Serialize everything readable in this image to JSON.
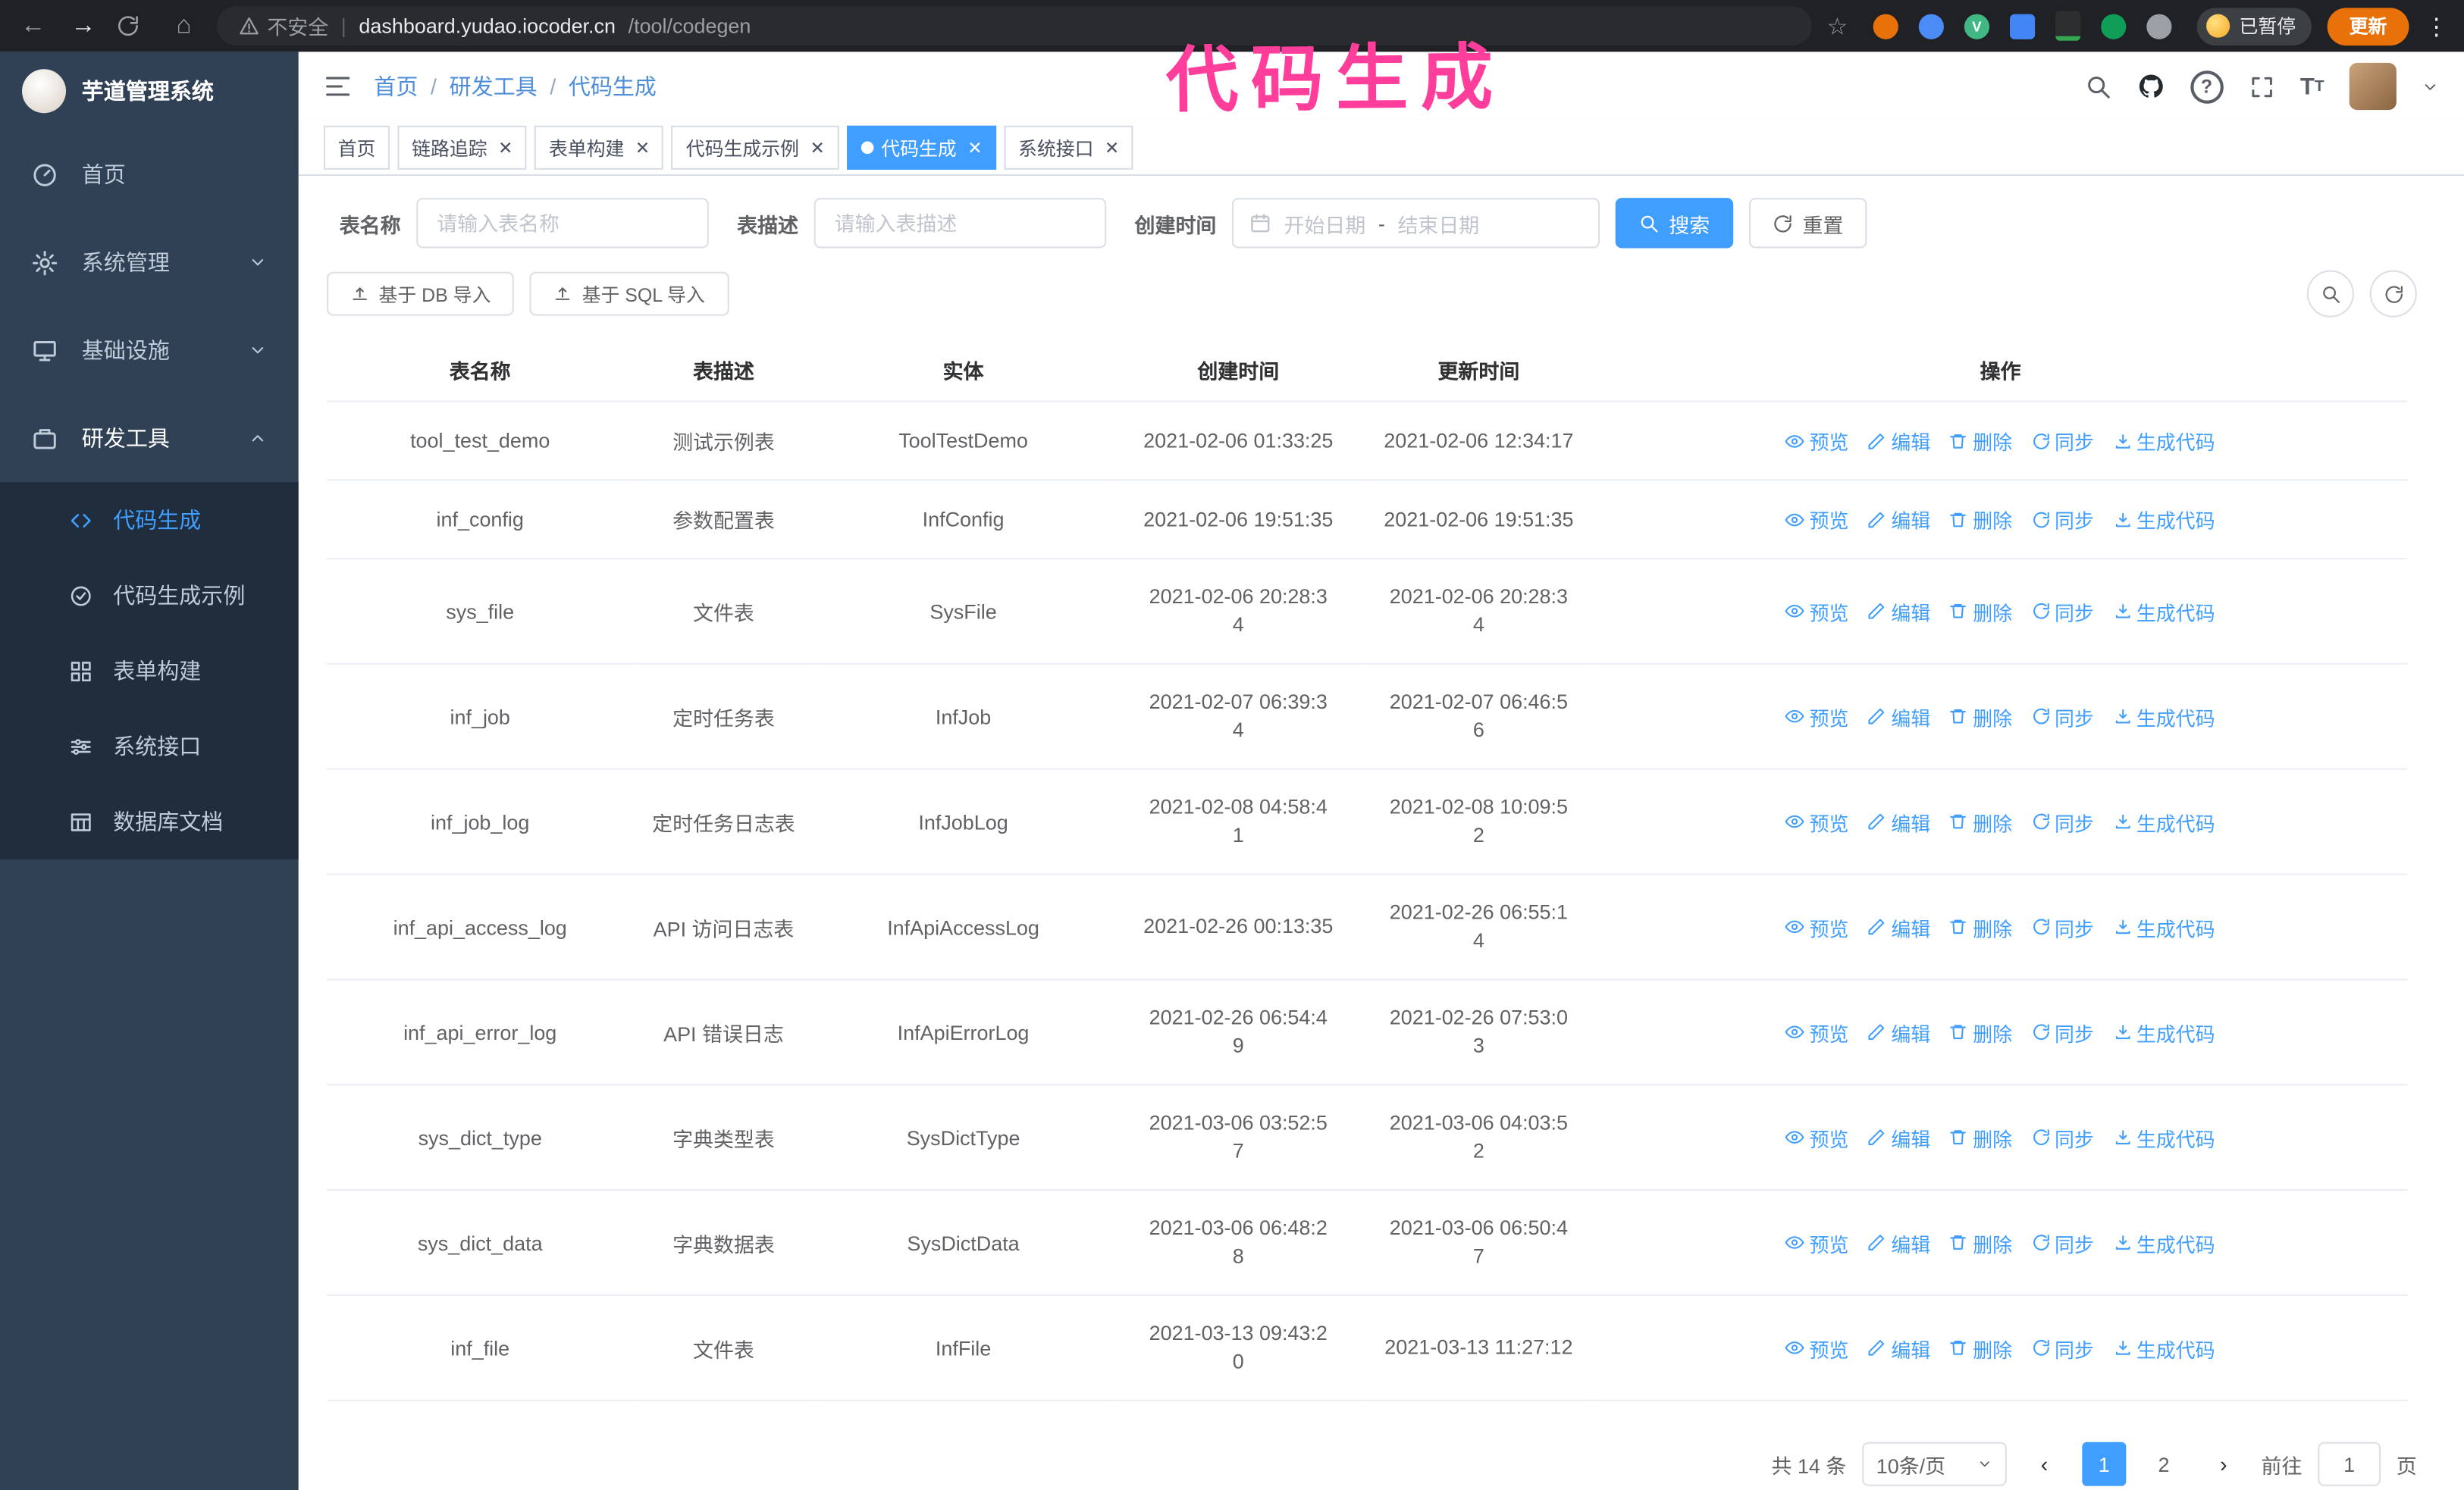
{
  "browser": {
    "security_label": "不安全",
    "url_host": "dashboard.yudao.iocoder.cn",
    "url_path": "/tool/codegen",
    "paused_badge": "已暂停",
    "update_button": "更新"
  },
  "annotation": {
    "text": "代码生成"
  },
  "sidebar": {
    "logo_title": "芋道管理系统",
    "items": [
      {
        "label": "首页"
      },
      {
        "label": "系统管理"
      },
      {
        "label": "基础设施"
      },
      {
        "label": "研发工具"
      }
    ],
    "submenu": [
      {
        "label": "代码生成",
        "active": true
      },
      {
        "label": "代码生成示例"
      },
      {
        "label": "表单构建"
      },
      {
        "label": "系统接口"
      },
      {
        "label": "数据库文档"
      }
    ]
  },
  "header": {
    "breadcrumb": [
      "首页",
      "研发工具",
      "代码生成"
    ]
  },
  "tabs": [
    {
      "label": "首页",
      "closable": false
    },
    {
      "label": "链路追踪",
      "closable": true
    },
    {
      "label": "表单构建",
      "closable": true
    },
    {
      "label": "代码生成示例",
      "closable": true
    },
    {
      "label": "代码生成",
      "closable": true,
      "active": true
    },
    {
      "label": "系统接口",
      "closable": true
    }
  ],
  "filters": {
    "table_name_label": "表名称",
    "table_name_placeholder": "请输入表名称",
    "table_desc_label": "表描述",
    "table_desc_placeholder": "请输入表描述",
    "create_time_label": "创建时间",
    "date_start_placeholder": "开始日期",
    "date_separator": "-",
    "date_end_placeholder": "结束日期",
    "search_button": "搜索",
    "reset_button": "重置"
  },
  "toolbar": {
    "import_db": "基于 DB 导入",
    "import_sql": "基于 SQL 导入"
  },
  "table": {
    "columns": [
      "表名称",
      "表描述",
      "实体",
      "创建时间",
      "更新时间",
      "操作"
    ],
    "actions": [
      "预览",
      "编辑",
      "删除",
      "同步",
      "生成代码"
    ],
    "rows": [
      {
        "name": "tool_test_demo",
        "desc": "测试示例表",
        "entity": "ToolTestDemo",
        "created": "2021-02-06 01:33:25",
        "updated": "2021-02-06 12:34:17"
      },
      {
        "name": "inf_config",
        "desc": "参数配置表",
        "entity": "InfConfig",
        "created": "2021-02-06 19:51:35",
        "updated": "2021-02-06 19:51:35"
      },
      {
        "name": "sys_file",
        "desc": "文件表",
        "entity": "SysFile",
        "created": "2021-02-06 20:28:3\n4",
        "updated": "2021-02-06 20:28:3\n4"
      },
      {
        "name": "inf_job",
        "desc": "定时任务表",
        "entity": "InfJob",
        "created": "2021-02-07 06:39:3\n4",
        "updated": "2021-02-07 06:46:5\n6"
      },
      {
        "name": "inf_job_log",
        "desc": "定时任务日志表",
        "entity": "InfJobLog",
        "created": "2021-02-08 04:58:4\n1",
        "updated": "2021-02-08 10:09:5\n2"
      },
      {
        "name": "inf_api_access_log",
        "desc": "API 访问日志表",
        "entity": "InfApiAccessLog",
        "created": "2021-02-26 00:13:35",
        "updated": "2021-02-26 06:55:1\n4"
      },
      {
        "name": "inf_api_error_log",
        "desc": "API 错误日志",
        "entity": "InfApiErrorLog",
        "created": "2021-02-26 06:54:4\n9",
        "updated": "2021-02-26 07:53:0\n3"
      },
      {
        "name": "sys_dict_type",
        "desc": "字典类型表",
        "entity": "SysDictType",
        "created": "2021-03-06 03:52:5\n7",
        "updated": "2021-03-06 04:03:5\n2"
      },
      {
        "name": "sys_dict_data",
        "desc": "字典数据表",
        "entity": "SysDictData",
        "created": "2021-03-06 06:48:2\n8",
        "updated": "2021-03-06 06:50:4\n7"
      },
      {
        "name": "inf_file",
        "desc": "文件表",
        "entity": "InfFile",
        "created": "2021-03-13 09:43:2\n0",
        "updated": "2021-03-13 11:27:12"
      }
    ]
  },
  "pagination": {
    "total": "共 14 条",
    "page_size": "10条/页",
    "pages": [
      "1",
      "2"
    ],
    "goto_label": "前往",
    "goto_value": "1",
    "goto_suffix": "页"
  },
  "colors": {
    "accent": "#409eff",
    "sidebar_bg": "#304156",
    "submenu_bg": "#1f2d3d",
    "annotation_pink": "#ff3e9c"
  }
}
